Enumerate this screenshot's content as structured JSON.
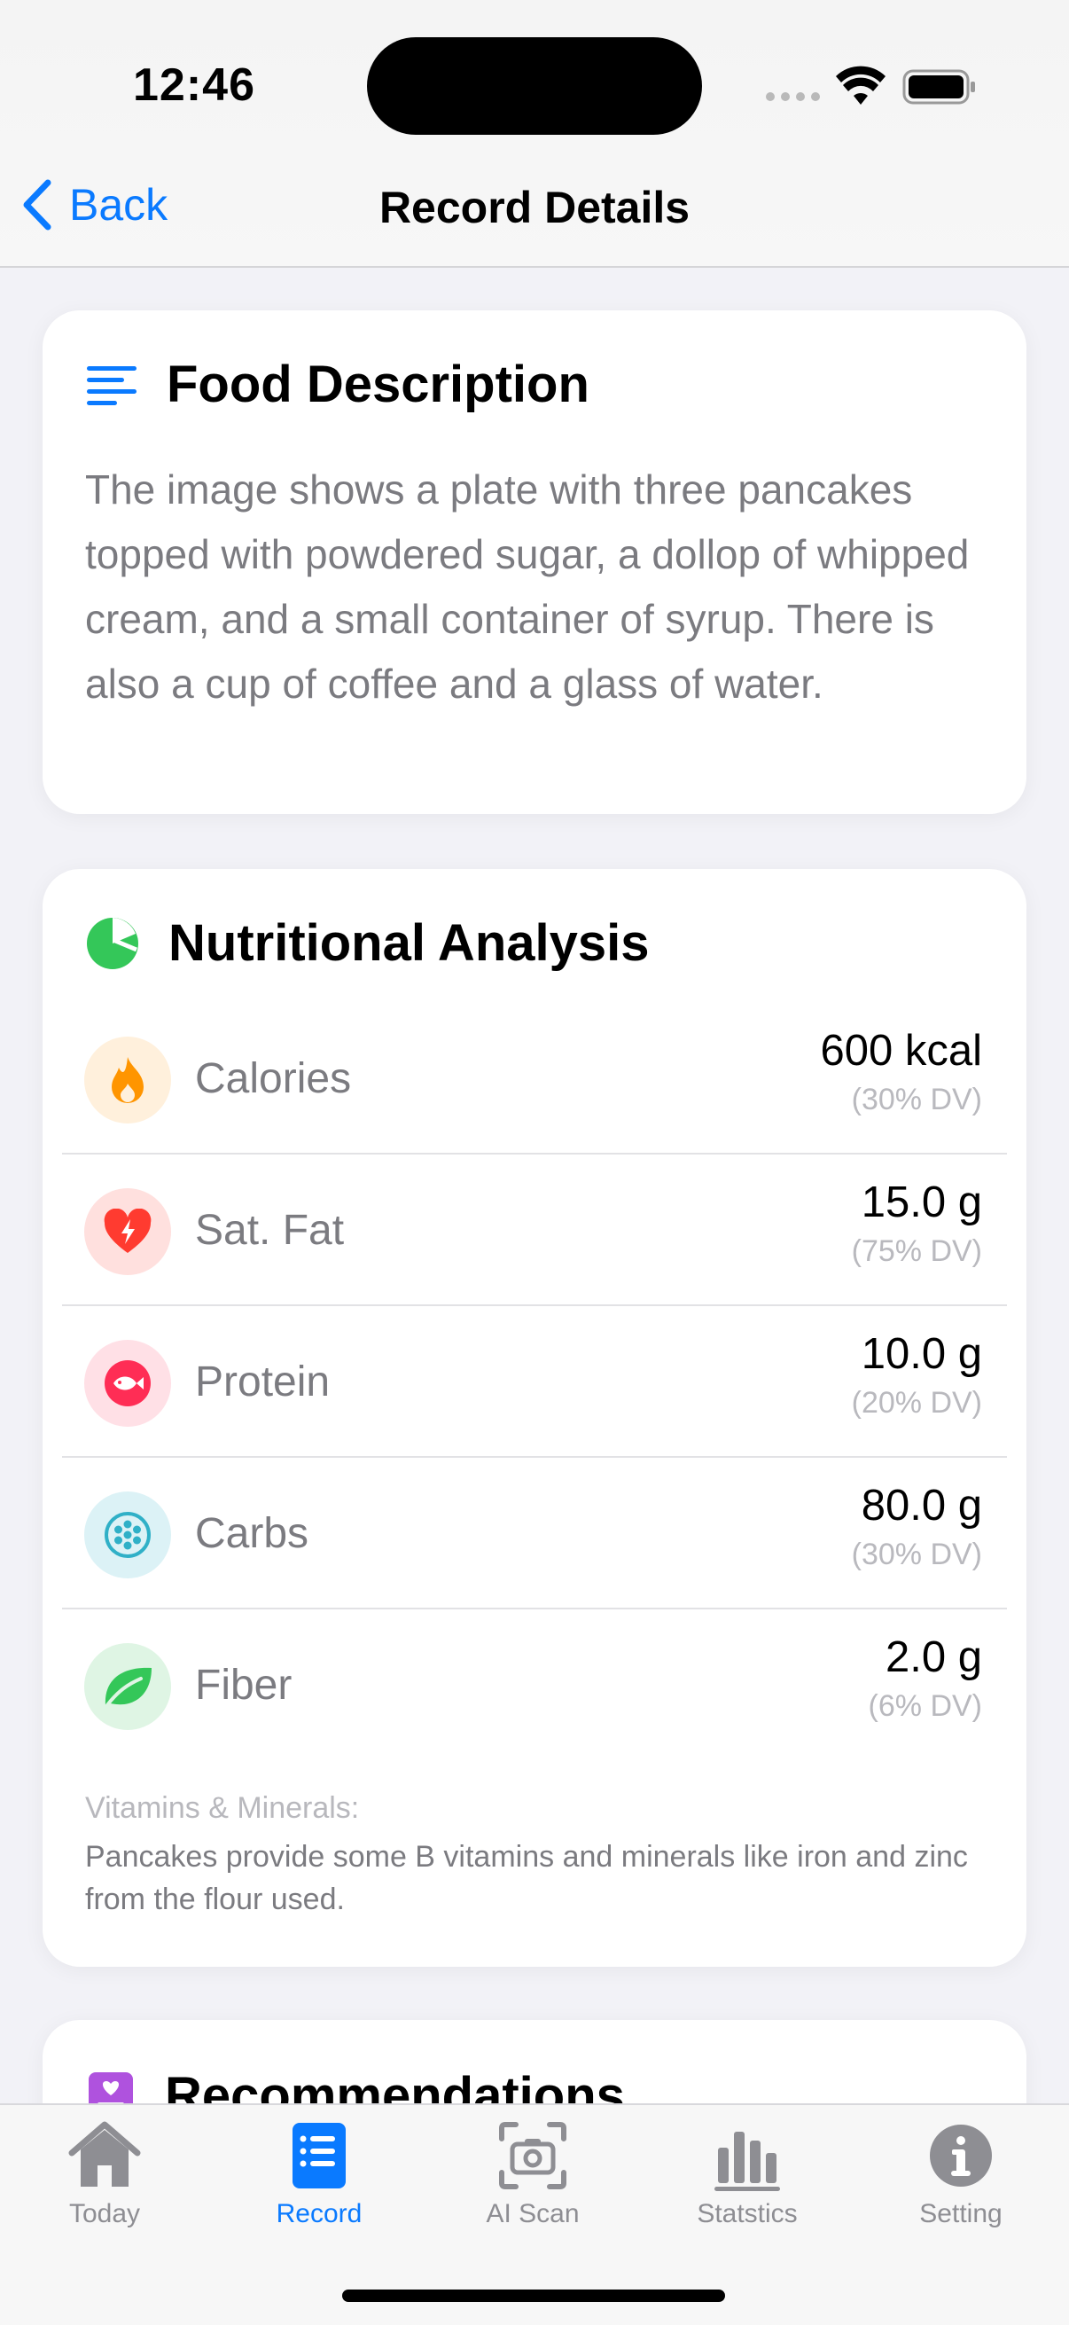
{
  "status_bar": {
    "time": "12:46"
  },
  "nav": {
    "back_label": "Back",
    "title": "Record Details"
  },
  "food_description": {
    "title": "Food Description",
    "text": "The image shows a plate with three pancakes topped with powdered sugar, a dollop of whipped cream, and a small container of syrup. There is also a cup of coffee and a glass of water."
  },
  "nutrition": {
    "title": "Nutritional Analysis",
    "rows": [
      {
        "label": "Calories",
        "value": "600 kcal",
        "dv": "(30% DV)",
        "icon": "flame-icon",
        "color": "#ff9500"
      },
      {
        "label": "Sat. Fat",
        "value": "15.0 g",
        "dv": "(75% DV)",
        "icon": "heart-bolt-icon",
        "color": "#ff3b30"
      },
      {
        "label": "Protein",
        "value": "10.0 g",
        "dv": "(20% DV)",
        "icon": "fish-icon",
        "color": "#ff2d55"
      },
      {
        "label": "Carbs",
        "value": "80.0 g",
        "dv": "(30% DV)",
        "icon": "grain-icon",
        "color": "#30b0c7"
      },
      {
        "label": "Fiber",
        "value": "2.0 g",
        "dv": "(6% DV)",
        "icon": "leaf-icon",
        "color": "#34c759"
      }
    ],
    "vitamins_label": "Vitamins & Minerals:",
    "vitamins_text": "Pancakes provide some B vitamins and minerals like iron and zinc from the flour used."
  },
  "recommendations": {
    "title": "Recommendations"
  },
  "tabs": [
    {
      "label": "Today",
      "icon": "house-icon"
    },
    {
      "label": "Record",
      "icon": "list-icon",
      "active": true
    },
    {
      "label": "AI Scan",
      "icon": "camera-scan-icon"
    },
    {
      "label": "Statstics",
      "icon": "bar-chart-icon"
    },
    {
      "label": "Setting",
      "icon": "info-icon"
    }
  ],
  "colors": {
    "accent": "#0a7aff",
    "pie": "#34c759",
    "recommend": "#af52de"
  }
}
